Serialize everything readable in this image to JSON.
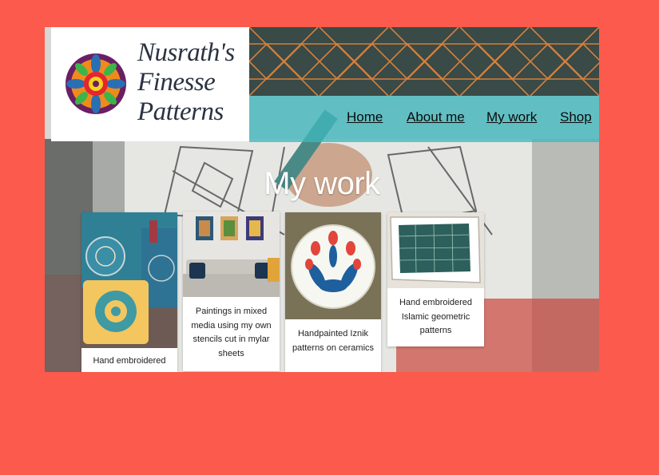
{
  "brand": {
    "name_line1": "Nusrath's",
    "name_line2": "Finesse",
    "name_line3": "Patterns"
  },
  "nav": {
    "home": "Home",
    "about": "About me",
    "work": "My work",
    "shop": "Shop"
  },
  "page": {
    "title": "My work"
  },
  "cards": [
    {
      "caption": "Hand embroidered"
    },
    {
      "caption": "Paintings in mixed media using my own stencils cut in mylar sheets"
    },
    {
      "caption": "Handpainted Iznik patterns on ceramics"
    },
    {
      "caption": "Hand embroidered Islamic geometric patterns"
    }
  ],
  "colors": {
    "page_background": "#fb5a4c",
    "nav_band": "#40b7be",
    "pattern_dark": "#394a47",
    "pattern_line": "#d5803c",
    "logo_text": "#2b3342"
  },
  "icons": {
    "logo": "mandala-logo-icon"
  }
}
